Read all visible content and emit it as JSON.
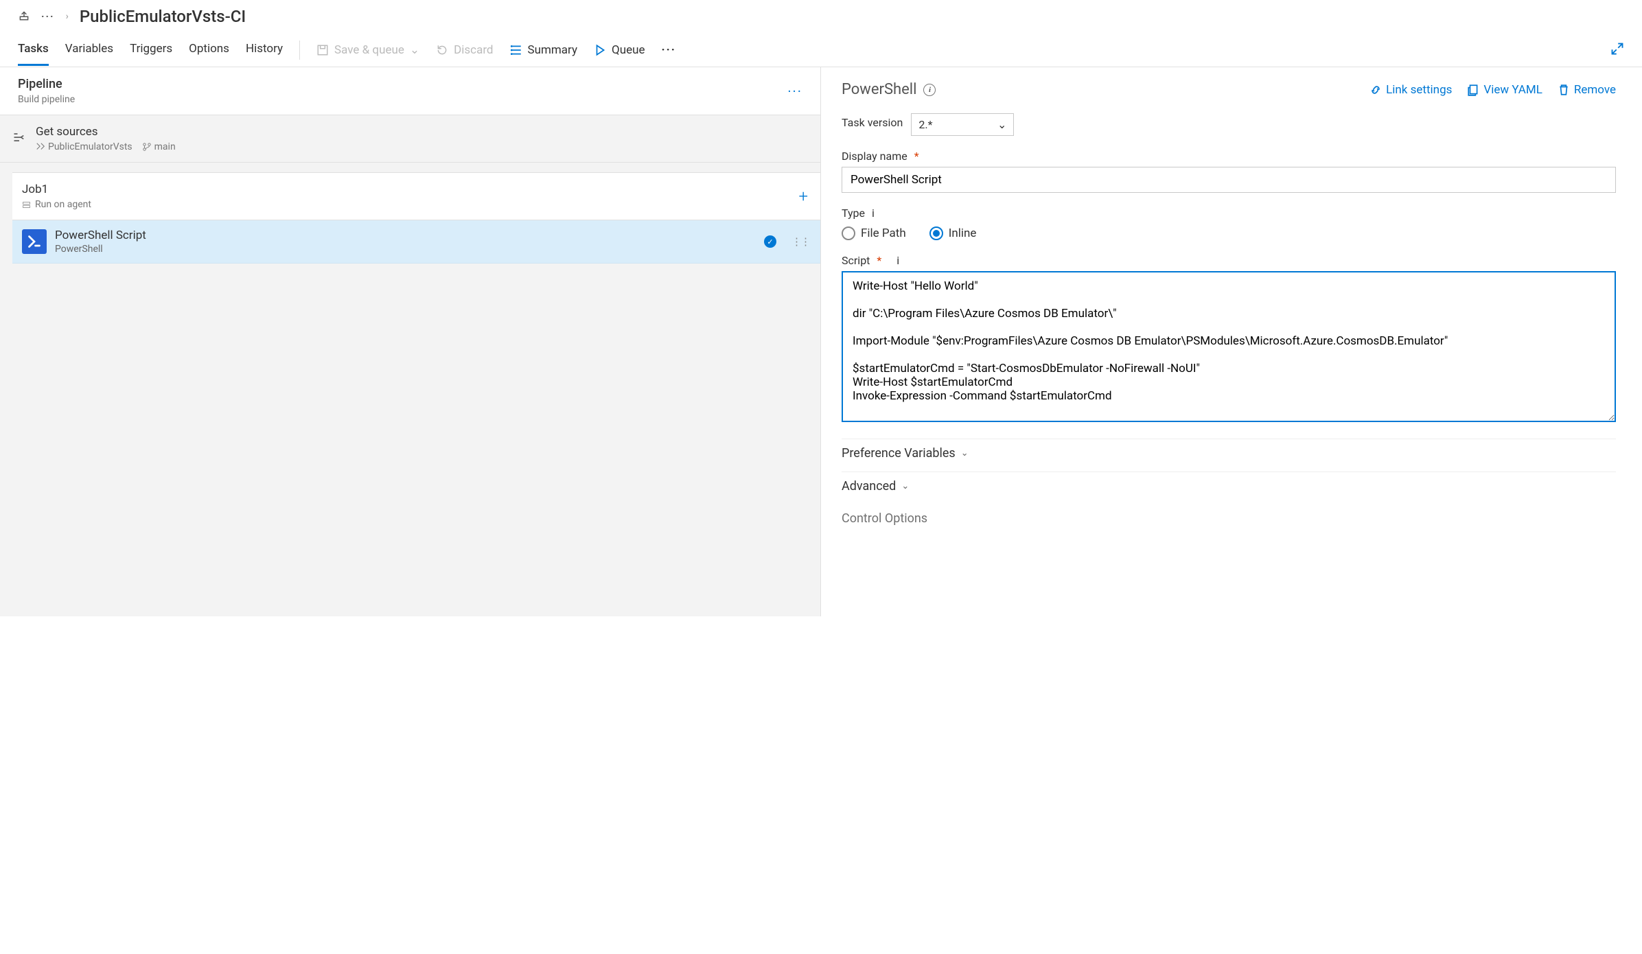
{
  "breadcrumb": {
    "title": "PublicEmulatorVsts-CI"
  },
  "tabs": {
    "tasks": "Tasks",
    "variables": "Variables",
    "triggers": "Triggers",
    "options": "Options",
    "history": "History"
  },
  "actions": {
    "save_queue": "Save & queue",
    "discard": "Discard",
    "summary": "Summary",
    "queue": "Queue"
  },
  "pipeline": {
    "title": "Pipeline",
    "subtitle": "Build pipeline"
  },
  "get_sources": {
    "title": "Get sources",
    "repo": "PublicEmulatorVsts",
    "branch": "main"
  },
  "job": {
    "title": "Job1",
    "subtitle": "Run on agent"
  },
  "task": {
    "title": "PowerShell Script",
    "subtitle": "PowerShell"
  },
  "right": {
    "title": "PowerShell",
    "link_settings": "Link settings",
    "view_yaml": "View YAML",
    "remove": "Remove",
    "task_version_label": "Task version",
    "task_version_value": "2.*",
    "display_name_label": "Display name",
    "display_name_value": "PowerShell Script",
    "type_label": "Type",
    "type_file_path": "File Path",
    "type_inline": "Inline",
    "script_label": "Script",
    "script_value": "Write-Host \"Hello World\"\n\ndir \"C:\\Program Files\\Azure Cosmos DB Emulator\\\"\n\nImport-Module \"$env:ProgramFiles\\Azure Cosmos DB Emulator\\PSModules\\Microsoft.Azure.CosmosDB.Emulator\"\n\n$startEmulatorCmd = \"Start-CosmosDbEmulator -NoFirewall -NoUI\"\nWrite-Host $startEmulatorCmd\nInvoke-Expression -Command $startEmulatorCmd",
    "pref_vars": "Preference Variables",
    "advanced": "Advanced",
    "control_options": "Control Options"
  }
}
